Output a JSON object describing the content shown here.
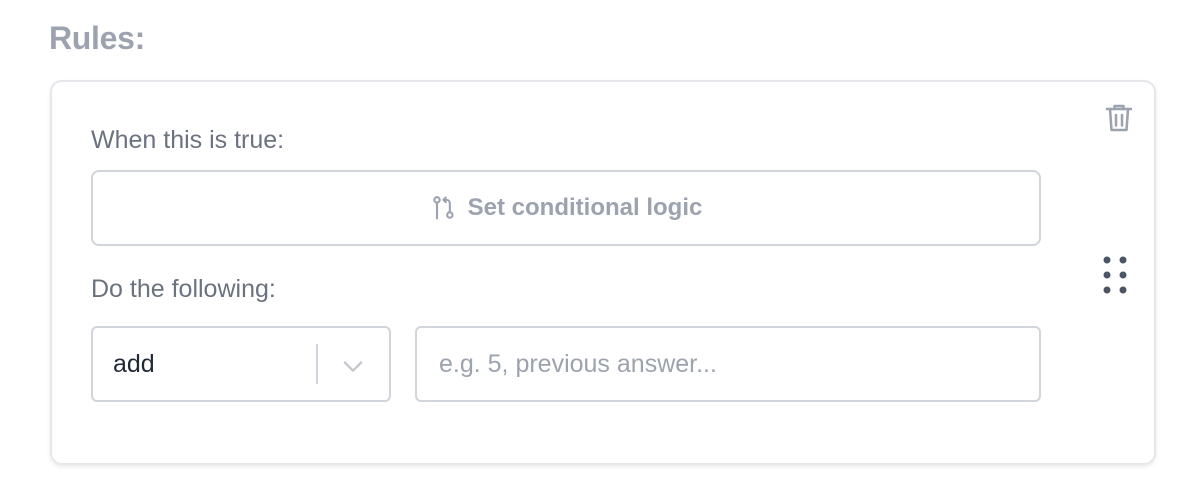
{
  "section": {
    "title": "Rules:"
  },
  "rule": {
    "when_label": "When this is true:",
    "conditional_button_label": "Set conditional logic",
    "do_label": "Do the following:",
    "operation": {
      "selected": "add"
    },
    "value_input": {
      "value": "",
      "placeholder": "e.g. 5, previous answer..."
    }
  },
  "icons": {
    "delete": "trash-icon",
    "drag": "drag-handle-icon",
    "conditional": "git-branch-icon",
    "dropdown": "chevron-down-icon"
  },
  "colors": {
    "muted_text": "#9ca3af",
    "label_text": "#6b7280",
    "border": "#d1d5db",
    "value_text": "#1f2937"
  }
}
